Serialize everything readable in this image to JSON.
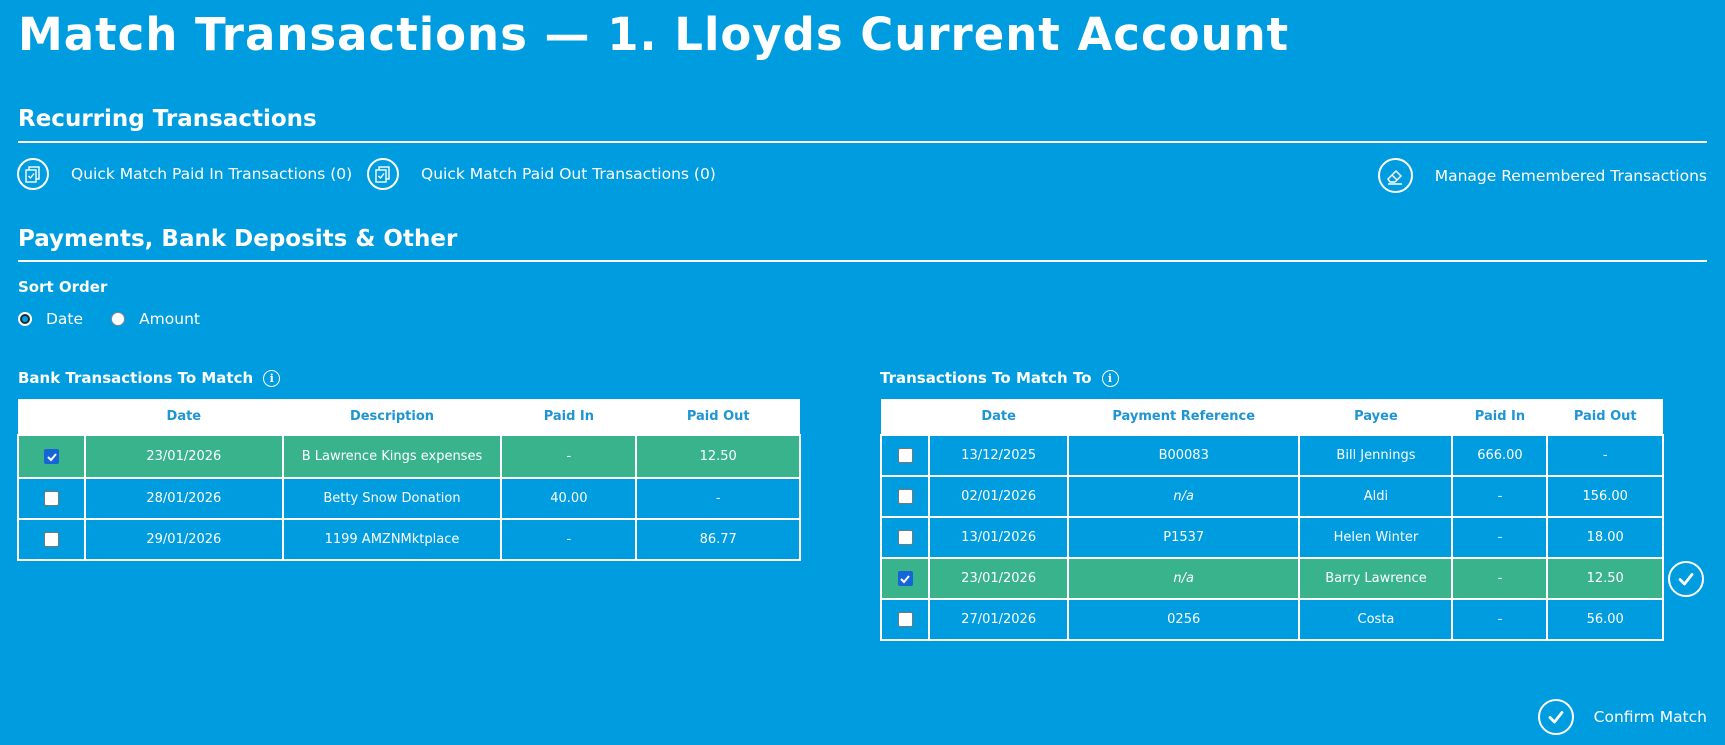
{
  "page": {
    "title": "Match Transactions — 1. Lloyds Current Account"
  },
  "recurring": {
    "heading": "Recurring Transactions",
    "quick_match_in": "Quick Match Paid In Transactions (0)",
    "quick_match_out": "Quick Match Paid Out Transactions (0)",
    "manage": "Manage Remembered Transactions"
  },
  "payments": {
    "heading": "Payments, Bank Deposits & Other",
    "sort_label": "Sort Order",
    "sort_options": [
      "Date",
      "Amount"
    ],
    "sort_selected": "Date"
  },
  "bank_table": {
    "title": "Bank Transactions To Match",
    "columns": [
      "",
      "Date",
      "Description",
      "Paid In",
      "Paid Out"
    ],
    "rows": [
      {
        "checked": true,
        "date": "23/01/2026",
        "description": "B Lawrence Kings expenses",
        "paid_in": "-",
        "paid_out": "12.50"
      },
      {
        "checked": false,
        "date": "28/01/2026",
        "description": "Betty Snow Donation",
        "paid_in": "40.00",
        "paid_out": "-"
      },
      {
        "checked": false,
        "date": "29/01/2026",
        "description": "1199 AMZNMktplace",
        "paid_in": "-",
        "paid_out": "86.77"
      }
    ]
  },
  "match_table": {
    "title": "Transactions To Match To",
    "columns": [
      "",
      "Date",
      "Payment Reference",
      "Payee",
      "Paid In",
      "Paid Out"
    ],
    "rows": [
      {
        "checked": false,
        "date": "13/12/2025",
        "reference": "B00083",
        "payee": "Bill Jennings",
        "paid_in": "666.00",
        "paid_out": "-"
      },
      {
        "checked": false,
        "date": "02/01/2026",
        "reference": "n/a",
        "payee": "Aldi",
        "paid_in": "-",
        "paid_out": "156.00"
      },
      {
        "checked": false,
        "date": "13/01/2026",
        "reference": "P1537",
        "payee": "Helen Winter",
        "paid_in": "-",
        "paid_out": "18.00"
      },
      {
        "checked": true,
        "date": "23/01/2026",
        "reference": "n/a",
        "payee": "Barry Lawrence",
        "paid_in": "-",
        "paid_out": "12.50"
      },
      {
        "checked": false,
        "date": "27/01/2026",
        "reference": "0256",
        "payee": "Costa",
        "paid_in": "-",
        "paid_out": "56.00"
      }
    ]
  },
  "confirm": {
    "label": "Confirm Match"
  },
  "colors": {
    "background": "#009ce0",
    "matched_row": "#38b38b",
    "header_text": "#1f95d3",
    "checkbox_checked": "#1565d8"
  },
  "icons": {
    "quick_match": "documents-check-icon",
    "manage": "eraser-icon",
    "info": "info-icon",
    "check": "check-circle-icon"
  }
}
